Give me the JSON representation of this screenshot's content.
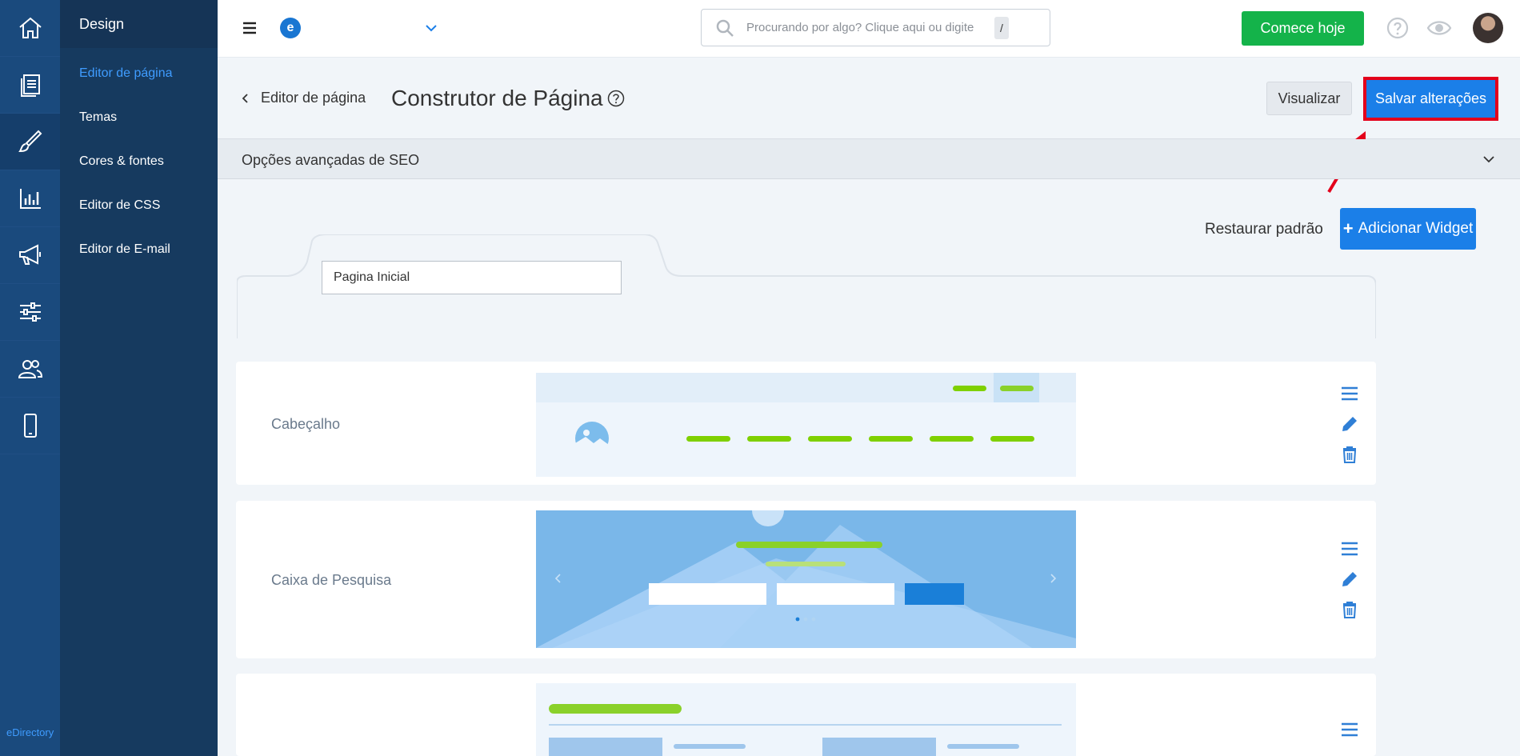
{
  "rail": {
    "brand": "eDirectory"
  },
  "submenu": {
    "title": "Design",
    "items": [
      {
        "label": "Editor de página"
      },
      {
        "label": "Temas"
      },
      {
        "label": "Cores & fontes"
      },
      {
        "label": "Editor de CSS"
      },
      {
        "label": "Editor de E-mail"
      }
    ]
  },
  "topbar": {
    "logo_letter": "e",
    "search_placeholder": "Procurando por algo? Clique aqui ou digite",
    "search_shortcut": "/",
    "start_button": "Comece hoje"
  },
  "header": {
    "back_label": "Editor de página",
    "title": "Construtor de Página",
    "preview_button": "Visualizar",
    "save_button": "Salvar alterações"
  },
  "seo": {
    "label": "Opções avançadas de SEO"
  },
  "toolbar": {
    "restore_label": "Restaurar padrão",
    "add_widget_label": "Adicionar Widget"
  },
  "page_name_value": "Pagina Inicial",
  "widgets": [
    {
      "label": "Cabeçalho"
    },
    {
      "label": "Caixa de Pesquisa"
    },
    {
      "label": ""
    }
  ],
  "colors": {
    "rail": "#1a4a7d",
    "submenu": "#163a5f",
    "accent_blue": "#1b7fe8",
    "green": "#14b34a",
    "highlight_red": "#e3001b"
  }
}
